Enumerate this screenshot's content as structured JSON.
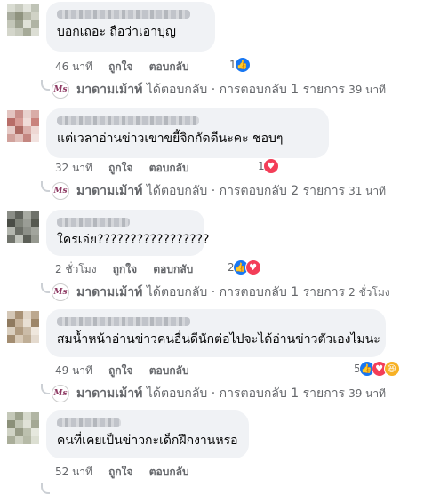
{
  "labels": {
    "like": "ถูกใจ",
    "reply": "ตอบกลับ"
  },
  "colors": {
    "like": "#1877f2",
    "love": "#f33e58",
    "haha": "#f7b125",
    "meta": "#65676b"
  },
  "comments": [
    {
      "text": "บอกเถอะ ถือว่าเอาบุญ",
      "time": "46 นาที",
      "reaction_count": "1",
      "reactions": [
        "like-icon"
      ],
      "reply_summary": {
        "author": "มาดามเม้าท์",
        "action": "ได้ตอบกลับ · การตอบกลับ 1 รายการ",
        "time": "39 นาที"
      }
    },
    {
      "text": "แต่เวลาอ่านข่าวเขาขยี้จิกกัดดีนะคะ ชอบๆ",
      "time": "32 นาที",
      "reaction_count": "1",
      "reactions": [
        "love-icon"
      ],
      "reply_summary": {
        "author": "มาดามเม้าท์",
        "action": "ได้ตอบกลับ · การตอบกลับ 2 รายการ",
        "time": "31 นาที"
      }
    },
    {
      "text": "ใครเอ่ย?????????????????",
      "time": "2 ชั่วโมง",
      "reaction_count": "2",
      "reactions": [
        "like-icon",
        "love-icon"
      ],
      "reply_summary": {
        "author": "มาดามเม้าท์",
        "action": "ได้ตอบกลับ · การตอบกลับ 1 รายการ",
        "time": "2 ชั่วโมง"
      }
    },
    {
      "text": "สมน้ำหน้าอ่านข่าวคนอื่นดีนักต่อไปจะได้อ่านข่าวตัวเองไมนะ",
      "time": "49 นาที",
      "reaction_count": "5",
      "reactions": [
        "like-icon",
        "love-icon",
        "haha-icon"
      ],
      "reply_summary": {
        "author": "มาดามเม้าท์",
        "action": "ได้ตอบกลับ · การตอบกลับ 1 รายการ",
        "time": "39 นาที"
      }
    },
    {
      "text": "คนที่เคยเป็นข่าวกะเด็กฝึกงานหรอ",
      "time": "52 นาที",
      "reaction_count": "",
      "reactions": [],
      "reply_summary": null
    }
  ]
}
